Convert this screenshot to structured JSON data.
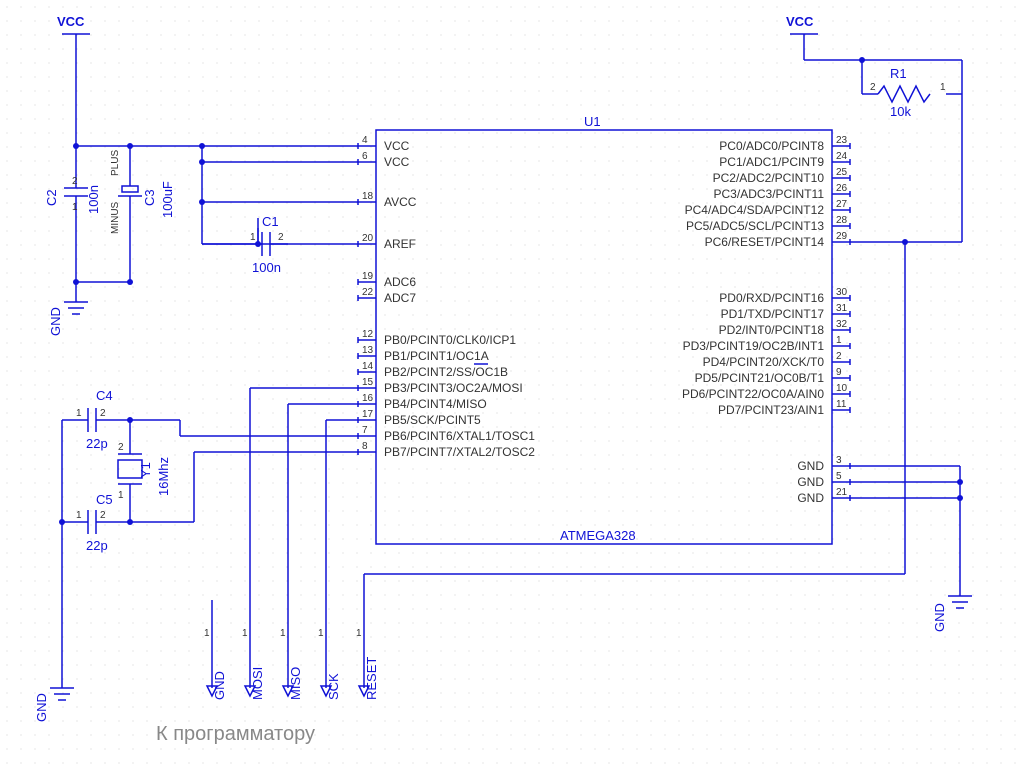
{
  "power": {
    "vcc_left": "VCC",
    "vcc_right": "VCC",
    "gnd_left": "GND",
    "gnd_pwr": "GND",
    "gnd_xtal": "GND",
    "gnd_right": "GND"
  },
  "refs": {
    "c1": "C1",
    "c1v": "100n",
    "c2": "C2",
    "c2v": "100n",
    "c3": "C3",
    "c3v": "100uF",
    "c3plus": "PLUS",
    "c3minus": "MINUS",
    "c4": "C4",
    "c4v": "22p",
    "c5": "C5",
    "c5v": "22p",
    "y1": "Y1",
    "y1v": "16Mhz",
    "r1": "R1",
    "r1v": "10k",
    "u1": "U1",
    "u1part": "ATMEGA328"
  },
  "programmer": {
    "title": "К программатору",
    "p1": "GND",
    "p2": "MOSI",
    "p3": "MISO",
    "p4": "SCK",
    "p5": "RESET"
  },
  "pins": {
    "left": [
      {
        "n": "4",
        "t": "VCC"
      },
      {
        "n": "6",
        "t": "VCC"
      },
      {
        "n": "18",
        "t": "AVCC"
      },
      {
        "n": "20",
        "t": "AREF"
      },
      {
        "n": "19",
        "t": "ADC6"
      },
      {
        "n": "22",
        "t": "ADC7"
      },
      {
        "n": "12",
        "t": "PB0/PCINT0/CLK0/ICP1"
      },
      {
        "n": "13",
        "t": "PB1/PCINT1/OC1A"
      },
      {
        "n": "14",
        "t": "~PB2/PCINT2/SS/OC1B"
      },
      {
        "n": "15",
        "t": "PB3/PCINT3/OC2A/MOSI"
      },
      {
        "n": "16",
        "t": "PB4/PCINT4/MISO"
      },
      {
        "n": "17",
        "t": "PB5/SCK/PCINT5"
      },
      {
        "n": "7",
        "t": "PB6/PCINT6/XTAL1/TOSC1"
      },
      {
        "n": "8",
        "t": "PB7/PCINT7/XTAL2/TOSC2"
      }
    ],
    "right": [
      {
        "n": "23",
        "t": "PC0/ADC0/PCINT8"
      },
      {
        "n": "24",
        "t": "PC1/ADC1/PCINT9"
      },
      {
        "n": "25",
        "t": "PC2/ADC2/PCINT10"
      },
      {
        "n": "26",
        "t": "PC3/ADC3/PCINT11"
      },
      {
        "n": "27",
        "t": "PC4/ADC4/SDA/PCINT12"
      },
      {
        "n": "28",
        "t": "~PC5/ADC5/SCL/PCINT13"
      },
      {
        "n": "29",
        "t": "~PC6/RESET/PCINT14"
      },
      {
        "n": "30",
        "t": "PD0/RXD/PCINT16"
      },
      {
        "n": "31",
        "t": "PD1/TXD/PCINT17"
      },
      {
        "n": "32",
        "t": "PD2/INT0/PCINT18"
      },
      {
        "n": "1",
        "t": "PD3/PCINT19/OC2B/INT1"
      },
      {
        "n": "2",
        "t": "PD4/PCINT20/XCK/T0"
      },
      {
        "n": "9",
        "t": "PD5/PCINT21/OC0B/T1"
      },
      {
        "n": "10",
        "t": "PD6/PCINT22/OC0A/AIN0"
      },
      {
        "n": "11",
        "t": "PD7/PCINT23/AIN1"
      },
      {
        "n": "3",
        "t": "GND"
      },
      {
        "n": "5",
        "t": "GND"
      },
      {
        "n": "21",
        "t": "GND"
      }
    ]
  },
  "pin_layout": {
    "left_y": [
      146,
      162,
      202,
      244,
      282,
      298,
      340,
      356,
      372,
      388,
      404,
      420,
      436,
      452
    ],
    "left_break_after": [
      1,
      2,
      3,
      5
    ],
    "right_y": [
      146,
      162,
      178,
      194,
      210,
      226,
      242,
      298,
      314,
      330,
      346,
      362,
      378,
      394,
      410,
      466,
      482,
      498
    ],
    "right_break_after": [
      6,
      14
    ]
  }
}
